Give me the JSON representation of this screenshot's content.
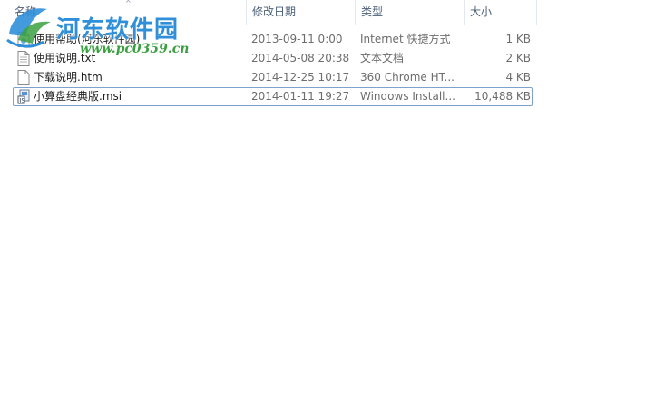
{
  "columns": {
    "name": "名称",
    "date": "修改日期",
    "type": "类型",
    "size": "大小"
  },
  "files": [
    {
      "name": "使用帮助(河东软件园)",
      "date": "2013-09-11 0:00",
      "type": "Internet 快捷方式",
      "size": "1 KB",
      "icon": "internet-shortcut-icon"
    },
    {
      "name": "使用说明.txt",
      "date": "2014-05-08 20:38",
      "type": "文本文档",
      "size": "2 KB",
      "icon": "text-file-icon"
    },
    {
      "name": "下载说明.htm",
      "date": "2014-12-25 10:17",
      "type": "360 Chrome HT...",
      "size": "4 KB",
      "icon": "htm-file-icon"
    },
    {
      "name": "小算盘经典版.msi",
      "date": "2014-01-11 19:27",
      "type": "Windows Install...",
      "size": "10,488 KB",
      "icon": "msi-installer-icon",
      "selected": true
    }
  ],
  "watermark": {
    "title": "河东软件园",
    "url": "www.pc0359.cn"
  },
  "colors": {
    "header_text": "#4c607a",
    "selection_border": "#7da2ce",
    "watermark_blue": "#2f8fd8",
    "watermark_green": "#3aa040"
  }
}
